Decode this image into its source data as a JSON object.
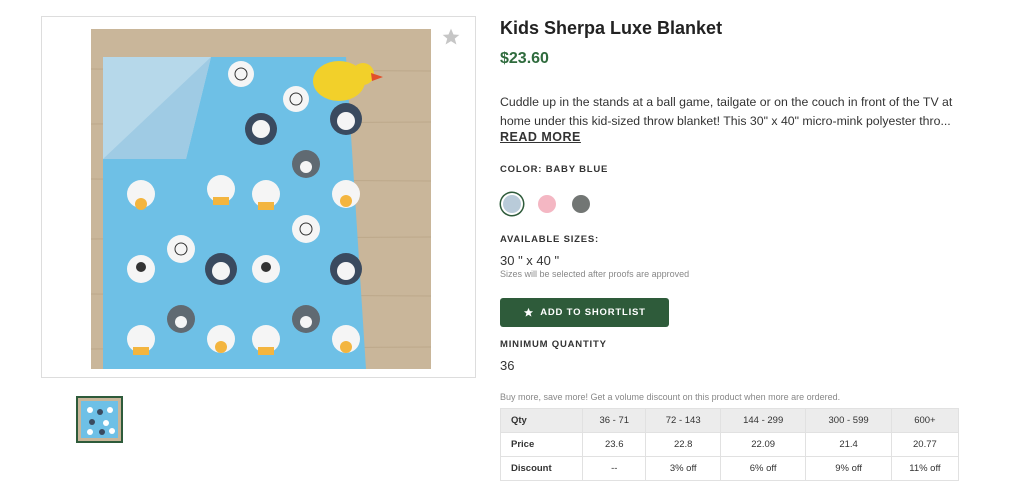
{
  "product": {
    "title": "Kids Sherpa Luxe Blanket",
    "price": "$23.60",
    "description_lines": [
      "Cuddle up in the stands at a ball game, tailgate or on the couch in front of the TV at",
      "home under this kid-sized throw blanket! This 30\" x 40\" micro-mink polyester thro..."
    ],
    "read_more": "READ MORE"
  },
  "color": {
    "label": "COLOR: BABY BLUE",
    "swatches": [
      {
        "name": "Baby Blue",
        "hex": "#b9cbd9",
        "selected": true
      },
      {
        "name": "Pink",
        "hex": "#f4b7c3",
        "selected": false
      },
      {
        "name": "Gray",
        "hex": "#727674",
        "selected": false
      }
    ]
  },
  "sizes": {
    "label": "AVAILABLE SIZES:",
    "value": "30 \" x 40 \"",
    "note": "Sizes will be selected after proofs are approved"
  },
  "shortlist_button": {
    "label": "ADD TO SHORTLIST",
    "icon": "star-icon"
  },
  "minimum_quantity": {
    "label": "MINIMUM QUANTITY",
    "value": "36"
  },
  "promo_text": "Buy more, save more! Get a volume discount on this product when more are ordered.",
  "volume_table": {
    "header": [
      "Qty",
      "36 - 71",
      "72 - 143",
      "144 - 299",
      "300 - 599",
      "600+"
    ],
    "price_row": [
      "Price",
      "23.6",
      "22.8",
      "22.09",
      "21.4",
      "20.77"
    ],
    "discount_row": [
      "Discount",
      "--",
      "3% off",
      "6% off",
      "9% off",
      "11% off"
    ]
  },
  "colors": {
    "brand_green": "#2e5b3a",
    "price_green": "#2f6b3d",
    "blanket_blue": "#6ec0e6"
  }
}
